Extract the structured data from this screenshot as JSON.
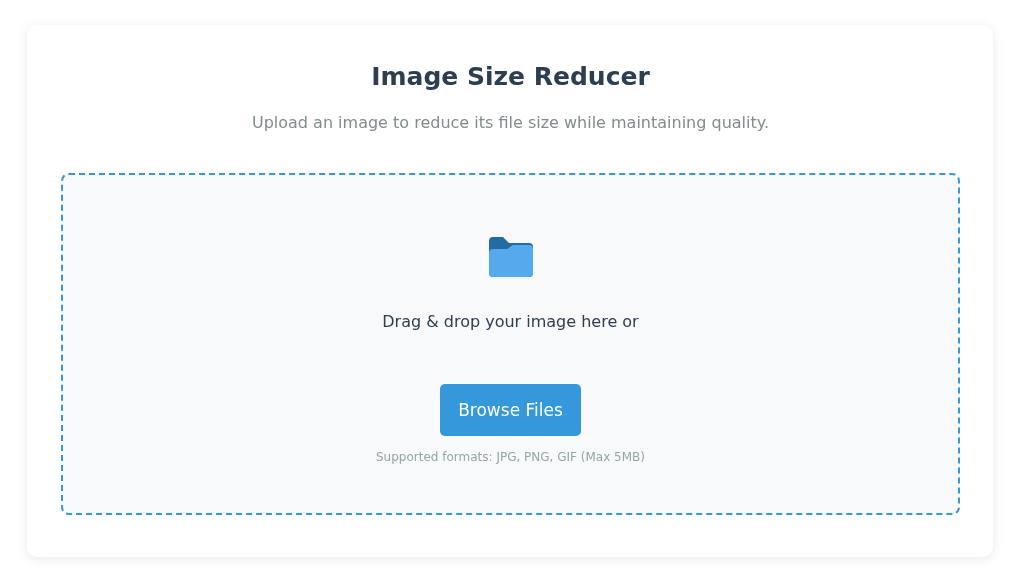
{
  "title": "Image Size Reducer",
  "subtitle": "Upload an image to reduce its file size while maintaining quality.",
  "dropzone": {
    "prompt": "Drag & drop your image here or",
    "button": "Browse Files",
    "hint": "Supported formats: JPG, PNG, GIF (Max 5MB)"
  }
}
